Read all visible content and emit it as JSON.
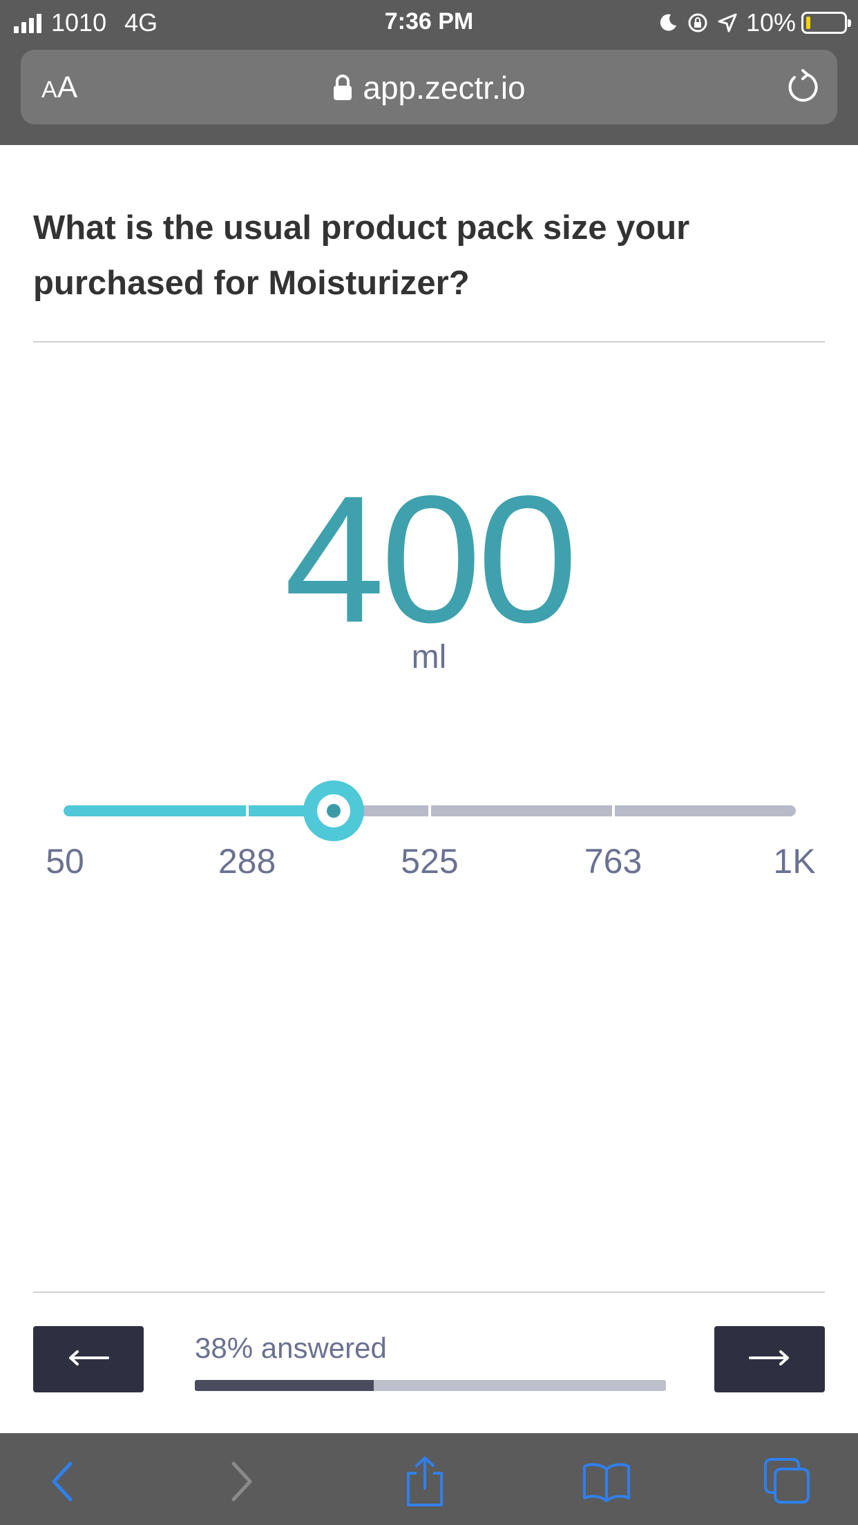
{
  "status_bar": {
    "carrier": "1010",
    "network": "4G",
    "time": "7:36 PM",
    "battery": "10%",
    "battery_level": 0.1,
    "icons": [
      "signal-icon",
      "moon-icon",
      "orientation-lock-icon",
      "location-icon",
      "battery-icon"
    ]
  },
  "browser": {
    "text_size_label": "AA",
    "url": "app.zectr.io",
    "icons": [
      "lock-icon",
      "reload-icon"
    ]
  },
  "question": {
    "text": "What is the usual product pack size your purchased for Moisturizer?"
  },
  "answer": {
    "value": "400",
    "unit": "ml"
  },
  "slider": {
    "min": 50,
    "max": 1000,
    "value": 400,
    "ticks": [
      "50",
      "288",
      "525",
      "763",
      "1K"
    ],
    "tick_values": [
      50,
      288,
      525,
      763,
      1000
    ]
  },
  "footer": {
    "back_icon": "arrow-left-icon",
    "next_icon": "arrow-right-icon",
    "progress_label": "38% answered",
    "progress": 0.38
  },
  "toolbar": {
    "icons": [
      "back-icon",
      "forward-icon",
      "share-icon",
      "bookmarks-icon",
      "tabs-icon"
    ]
  },
  "colors": {
    "accent": "#3fa1ad",
    "slider_active": "#4fc8d8",
    "slider_inactive": "#b8bac8",
    "button_dark": "#2e3042",
    "safari_blue": "#2f80ed",
    "chrome_gray": "#5b5b5b"
  }
}
